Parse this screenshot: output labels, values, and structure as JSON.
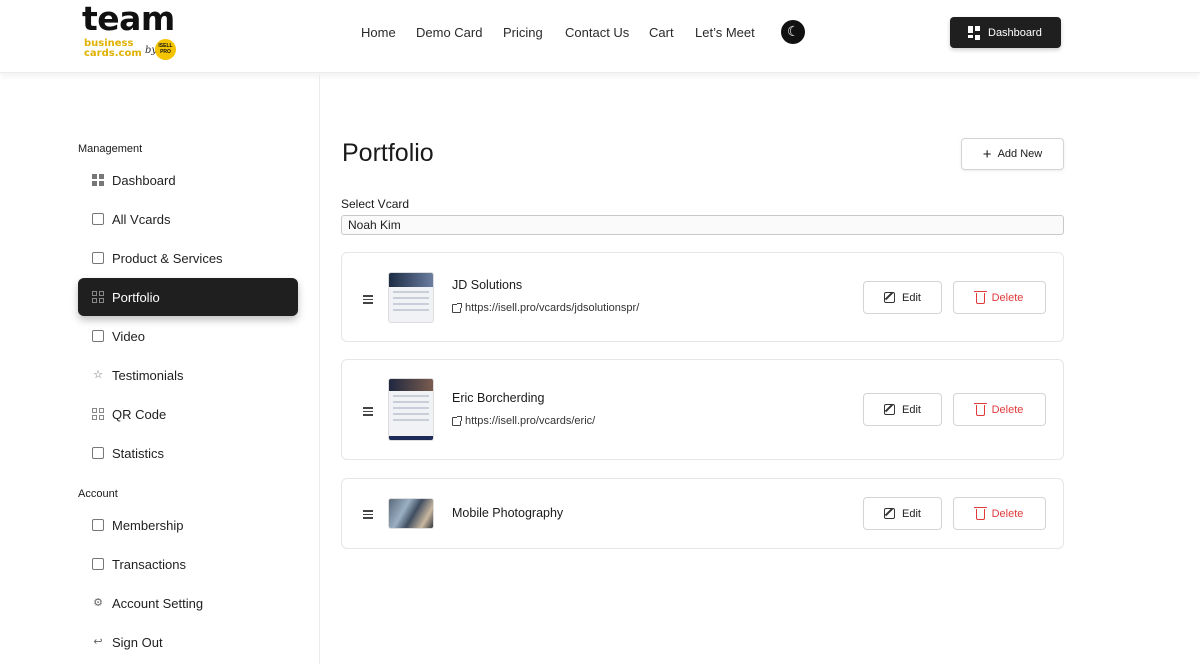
{
  "brand": {
    "logo_top": "team",
    "logo_line1": "business",
    "logo_line2": "cards.com",
    "logo_by": "by",
    "logo_badge": "ISELL PRO"
  },
  "nav": {
    "items": [
      {
        "label": "Home"
      },
      {
        "label": "Demo Card"
      },
      {
        "label": "Pricing"
      },
      {
        "label": "Contact Us"
      },
      {
        "label": "Cart"
      },
      {
        "label": "Let’s Meet"
      }
    ],
    "theme_icon": "moon-icon",
    "dashboard_label": "Dashboard"
  },
  "sidebar": {
    "management_title": "Management",
    "management_items": [
      {
        "label": "Dashboard",
        "icon": "dashboard-icon"
      },
      {
        "label": "All Vcards",
        "icon": "vcards-icon"
      },
      {
        "label": "Product & Services",
        "icon": "box-icon"
      },
      {
        "label": "Portfolio",
        "icon": "portfolio-icon",
        "active": true
      },
      {
        "label": "Video",
        "icon": "video-icon"
      },
      {
        "label": "Testimonials",
        "icon": "star-icon"
      },
      {
        "label": "QR Code",
        "icon": "qr-icon"
      },
      {
        "label": "Statistics",
        "icon": "chart-icon"
      }
    ],
    "account_title": "Account",
    "account_items": [
      {
        "label": "Membership",
        "icon": "gift-icon"
      },
      {
        "label": "Transactions",
        "icon": "document-icon"
      },
      {
        "label": "Account Setting",
        "icon": "settings-icon"
      },
      {
        "label": "Sign Out",
        "icon": "sign-out-icon"
      }
    ]
  },
  "main": {
    "title": "Portfolio",
    "add_new_label": "Add New",
    "select_label": "Select Vcard",
    "select_value": "Noah Kim",
    "edit_label": "Edit",
    "delete_label": "Delete",
    "items": [
      {
        "name": "JD Solutions",
        "url": "https://isell.pro/vcards/jdsolutionspr/"
      },
      {
        "name": "Eric Borcherding",
        "url": "https://isell.pro/vcards/eric/"
      },
      {
        "name": "Mobile Photography",
        "url": ""
      }
    ]
  },
  "colors": {
    "dark": "#1f1f1f",
    "accent_yellow": "#f5c400",
    "delete_red": "#e03b3b"
  }
}
